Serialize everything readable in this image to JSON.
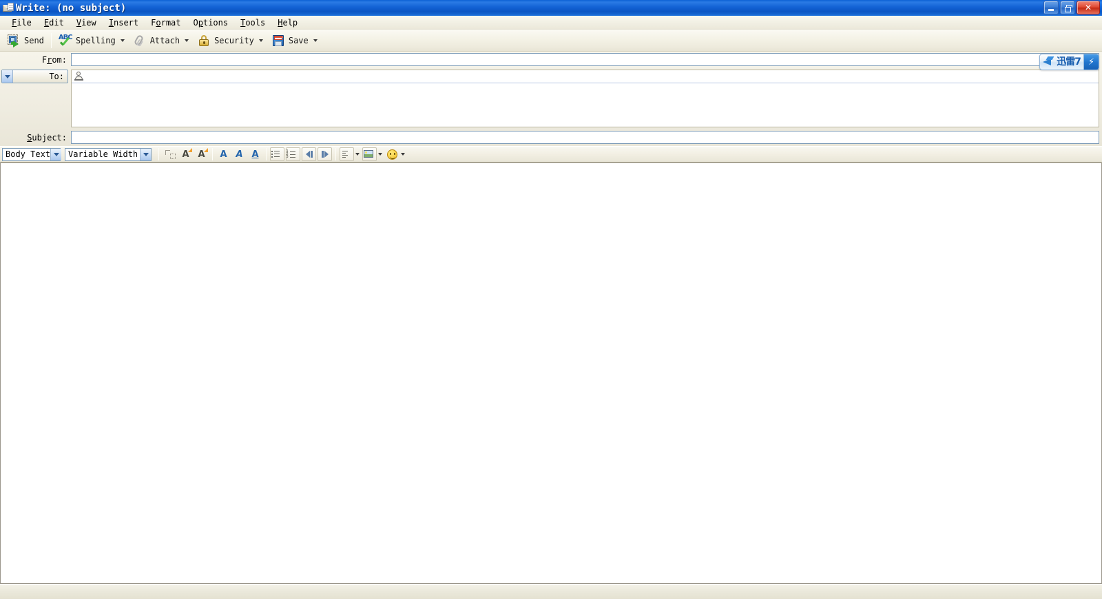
{
  "window": {
    "title": "Write: (no subject)",
    "icon": "compose-message-icon",
    "buttons": {
      "minimize": "Minimize",
      "restore": "Restore",
      "close": "Close"
    }
  },
  "menubar": {
    "items": [
      {
        "name": "file",
        "label": "File",
        "accel": "F"
      },
      {
        "name": "edit",
        "label": "Edit",
        "accel": "E"
      },
      {
        "name": "view",
        "label": "View",
        "accel": "V"
      },
      {
        "name": "insert",
        "label": "Insert",
        "accel": "I"
      },
      {
        "name": "format",
        "label": "Format",
        "accel": "o"
      },
      {
        "name": "options",
        "label": "Options",
        "accel": "p"
      },
      {
        "name": "tools",
        "label": "Tools",
        "accel": "T"
      },
      {
        "name": "help",
        "label": "Help",
        "accel": "H"
      }
    ]
  },
  "toolbar": {
    "send_label": "Send",
    "spelling_label": "Spelling",
    "attach_label": "Attach",
    "security_label": "Security",
    "save_label": "Save"
  },
  "headers": {
    "from_label": "From:",
    "from_value": "",
    "to_button_label": "To:",
    "to_value": "",
    "subject_label": "Subject:",
    "subject_value": "",
    "subject_placeholder": ""
  },
  "xunlei": {
    "label": "迅雷7",
    "bolt": "⚡"
  },
  "formatbar": {
    "paragraph_style": "Body Text",
    "font_family": "Variable Width",
    "buttons": [
      {
        "name": "discontinuous-selection",
        "label": "Discontinuous Selection"
      },
      {
        "name": "text-color",
        "label": "Text Color"
      },
      {
        "name": "highlight-color",
        "label": "Highlight Color"
      },
      {
        "name": "bold",
        "label": "A"
      },
      {
        "name": "italic",
        "label": "A"
      },
      {
        "name": "underline",
        "label": "A"
      },
      {
        "name": "bullet-list",
        "label": "Bulleted List"
      },
      {
        "name": "numbered-list",
        "label": "Numbered List"
      },
      {
        "name": "outdent",
        "label": "Decrease Indent"
      },
      {
        "name": "indent",
        "label": "Increase Indent"
      },
      {
        "name": "align",
        "label": "Align"
      },
      {
        "name": "insert-image",
        "label": "Insert Image"
      },
      {
        "name": "smiley",
        "label": "Insert Smiley"
      }
    ]
  },
  "body": {
    "content": ""
  },
  "statusbar": {
    "text": ""
  },
  "colors": {
    "title_blue": "#1464d6",
    "close_red": "#c32b15",
    "toolbar_beige": "#ece9d8",
    "field_border": "#7e9db9",
    "accent_blue": "#2566ad"
  }
}
